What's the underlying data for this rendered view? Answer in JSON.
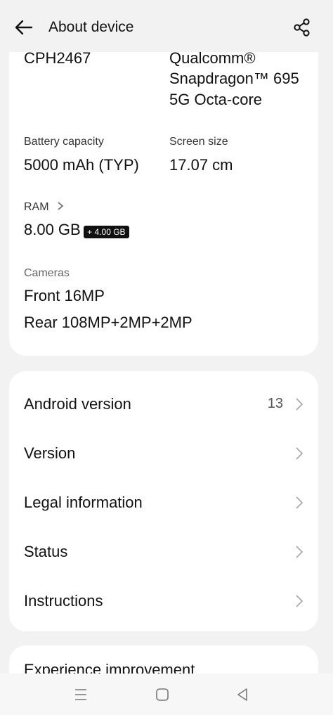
{
  "header": {
    "title": "About device"
  },
  "specs": {
    "model": "CPH2467",
    "processor_line1": "Qualcomm®",
    "processor_line2": "Snapdragon™ 695",
    "processor_line3": "5G Octa-core",
    "battery_label": "Battery capacity",
    "battery_value": "5000 mAh (TYP)",
    "screen_label": "Screen size",
    "screen_value": "17.07 cm",
    "ram_label": "RAM",
    "ram_value": "8.00 GB",
    "ram_extra": "+ 4.00 GB",
    "cameras_label": "Cameras",
    "camera_front": "Front 16MP",
    "camera_rear": "Rear 108MP+2MP+2MP"
  },
  "menu": {
    "items": [
      {
        "label": "Android version",
        "value": "13"
      },
      {
        "label": "Version",
        "value": ""
      },
      {
        "label": "Legal information",
        "value": ""
      },
      {
        "label": "Status",
        "value": ""
      },
      {
        "label": "Instructions",
        "value": ""
      }
    ]
  },
  "partial_card": {
    "text": "Experience improvement"
  },
  "icons": {
    "back": "arrow-left-icon",
    "share": "share-icon",
    "ram_chevron": "chevron-right-icon",
    "nav_menu": "menu-lines-icon",
    "nav_home": "square-home-icon",
    "nav_back": "triangle-back-icon"
  }
}
